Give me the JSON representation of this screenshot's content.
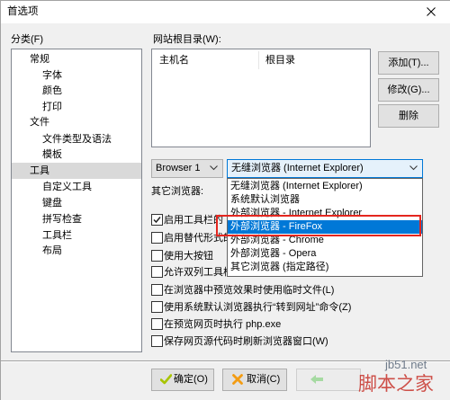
{
  "window": {
    "title": "首选项"
  },
  "icons": {
    "close": "close-icon",
    "chevron": "chevron-down-icon",
    "checkbox_mark": "checkmark-icon",
    "ok": "check-icon",
    "cancel": "x-icon",
    "back": "back-arrow-icon"
  },
  "categories": {
    "label": "分类(F)",
    "groups": [
      {
        "label": "常规",
        "children": [
          "字体",
          "颜色",
          "打印"
        ]
      },
      {
        "label": "文件",
        "children": [
          "文件类型及语法",
          "模板"
        ]
      },
      {
        "label": "工具",
        "children": [
          "自定义工具",
          "键盘",
          "拼写检查",
          "工具栏",
          "布局"
        ]
      }
    ],
    "selected_group_index": 2
  },
  "site_root": {
    "label": "网站根目录(W):",
    "columns": [
      "主机名",
      "根目录"
    ],
    "rows": [],
    "buttons": {
      "add": "添加(T)...",
      "edit": "修改(G)...",
      "delete": "删除"
    }
  },
  "browser": {
    "profile_selected": "Browser 1",
    "type_selected": "无缝浏览器 (Internet Explorer)",
    "other_label": "其它浏览器:",
    "type_options": [
      "无缝浏览器 (Internet Explorer)",
      "系统默认浏览器",
      "外部浏览器 - Internet Explorer",
      "外部浏览器 - FireFox",
      "外部浏览器 - Chrome",
      "外部浏览器 - Opera",
      "其它浏览器 (指定路径)"
    ],
    "highlighted_option_index": 3
  },
  "checkboxes": [
    {
      "label": "启用工具栏的",
      "checked": true
    },
    {
      "label": "启用替代形式的",
      "checked": false
    },
    {
      "label": "使用大按钮",
      "checked": false
    },
    {
      "label": "允许双列工具栏",
      "checked": false
    },
    {
      "label": "在浏览器中预览效果时使用临时文件(L)",
      "checked": false
    },
    {
      "label": "使用系统默认浏览器执行“转到网址”命令(Z)",
      "checked": false
    },
    {
      "label": "在预览网页时执行 php.exe",
      "checked": false
    },
    {
      "label": "保存网页源代码时刷新浏览器窗口(W)",
      "checked": false
    }
  ],
  "footer": {
    "ok_label": "确定(O)",
    "cancel_label": "取消(C)"
  },
  "watermark": {
    "site": "jb51.net",
    "name": "脚本之家"
  },
  "colors": {
    "accent": "#0078d7",
    "selection_inactive": "#d9d9d9",
    "annotation": "#e4261f",
    "ok_icon": "#a8c400",
    "cancel_icon": "#f39c12",
    "back_icon": "#8fd48a",
    "watermark": "#c8332b"
  }
}
